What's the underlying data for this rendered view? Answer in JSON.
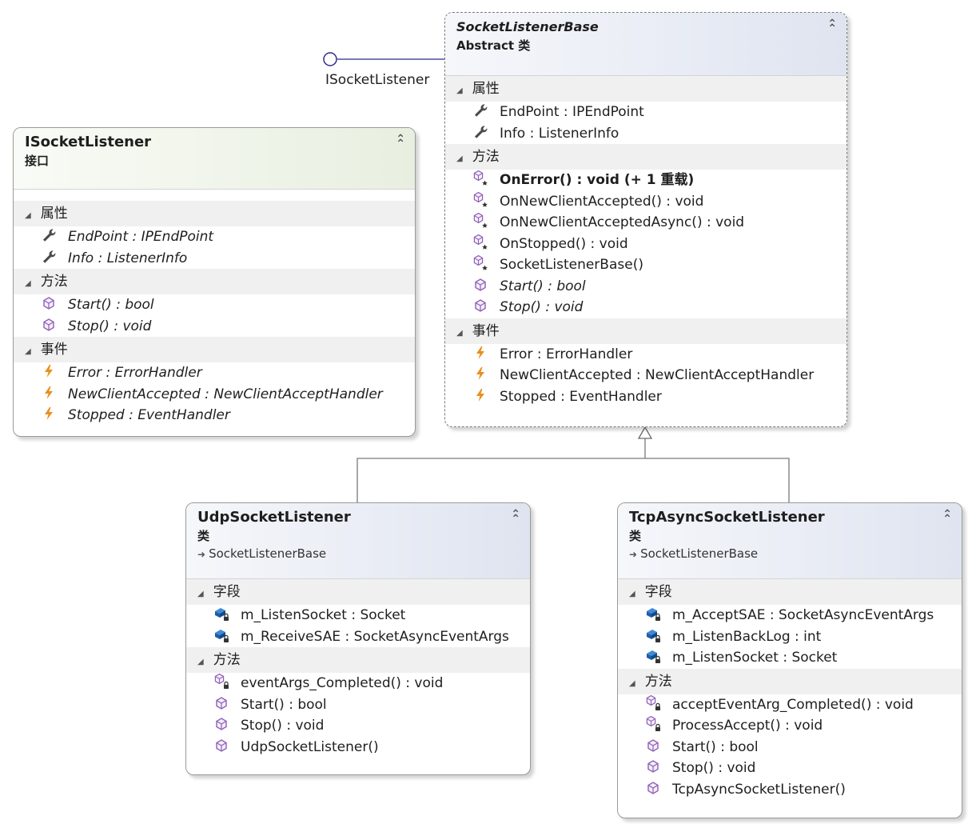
{
  "interface_label": "ISocketListener",
  "boxes": {
    "isocket": {
      "title": "ISocketListener",
      "stereotype": "接口",
      "sections": [
        {
          "title": "属性",
          "members": [
            {
              "icon": "wrench-icon",
              "text": "EndPoint : IPEndPoint"
            },
            {
              "icon": "wrench-icon",
              "text": "Info : ListenerInfo"
            }
          ]
        },
        {
          "title": "方法",
          "members": [
            {
              "icon": "method-cube-icon",
              "text": "Start() : bool"
            },
            {
              "icon": "method-cube-icon",
              "text": "Stop() : void"
            }
          ]
        },
        {
          "title": "事件",
          "members": [
            {
              "icon": "lightning-icon",
              "text": "Error : ErrorHandler"
            },
            {
              "icon": "lightning-icon",
              "text": "NewClientAccepted : NewClientAcceptHandler"
            },
            {
              "icon": "lightning-icon",
              "text": "Stopped : EventHandler"
            }
          ]
        }
      ]
    },
    "base": {
      "title": "SocketListenerBase",
      "stereotype": "Abstract 类",
      "sections": [
        {
          "title": "属性",
          "members": [
            {
              "icon": "wrench-icon",
              "text": "EndPoint : IPEndPoint"
            },
            {
              "icon": "wrench-icon",
              "text": "Info : ListenerInfo"
            }
          ]
        },
        {
          "title": "方法",
          "members": [
            {
              "icon": "protected-method-icon",
              "text": "OnError() : void (+ 1 重载)"
            },
            {
              "icon": "protected-method-icon",
              "text": "OnNewClientAccepted() : void"
            },
            {
              "icon": "protected-method-icon",
              "text": "OnNewClientAcceptedAsync() : void"
            },
            {
              "icon": "protected-method-icon",
              "text": "OnStopped() : void"
            },
            {
              "icon": "protected-method-icon",
              "text": "SocketListenerBase()"
            },
            {
              "icon": "method-cube-icon",
              "text": "Start() : bool"
            },
            {
              "icon": "method-cube-icon",
              "text": "Stop() : void"
            }
          ]
        },
        {
          "title": "事件",
          "members": [
            {
              "icon": "lightning-icon",
              "text": "Error : ErrorHandler"
            },
            {
              "icon": "lightning-icon",
              "text": "NewClientAccepted : NewClientAcceptHandler"
            },
            {
              "icon": "lightning-icon",
              "text": "Stopped : EventHandler"
            }
          ]
        }
      ]
    },
    "udp": {
      "title": "UdpSocketListener",
      "stereotype": "类",
      "base": "SocketListenerBase",
      "sections": [
        {
          "title": "字段",
          "members": [
            {
              "icon": "private-field-icon",
              "text": "m_ListenSocket : Socket"
            },
            {
              "icon": "private-field-icon",
              "text": "m_ReceiveSAE : SocketAsyncEventArgs"
            }
          ]
        },
        {
          "title": "方法",
          "members": [
            {
              "icon": "private-method-icon",
              "text": "eventArgs_Completed() : void"
            },
            {
              "icon": "method-cube-icon",
              "text": "Start() : bool"
            },
            {
              "icon": "method-cube-icon",
              "text": "Stop() : void"
            },
            {
              "icon": "method-cube-icon",
              "text": "UdpSocketListener()"
            }
          ]
        }
      ]
    },
    "tcp": {
      "title": "TcpAsyncSocketListener",
      "stereotype": "类",
      "base": "SocketListenerBase",
      "sections": [
        {
          "title": "字段",
          "members": [
            {
              "icon": "private-field-icon",
              "text": "m_AcceptSAE : SocketAsyncEventArgs"
            },
            {
              "icon": "private-field-icon",
              "text": "m_ListenBackLog : int"
            },
            {
              "icon": "private-field-icon",
              "text": "m_ListenSocket : Socket"
            }
          ]
        },
        {
          "title": "方法",
          "members": [
            {
              "icon": "private-method-icon",
              "text": "acceptEventArg_Completed() : void"
            },
            {
              "icon": "private-method-icon",
              "text": "ProcessAccept() : void"
            },
            {
              "icon": "method-cube-icon",
              "text": "Start() : bool"
            },
            {
              "icon": "method-cube-icon",
              "text": "Stop() : void"
            },
            {
              "icon": "method-cube-icon",
              "text": "TcpAsyncSocketListener()"
            }
          ]
        }
      ]
    }
  }
}
